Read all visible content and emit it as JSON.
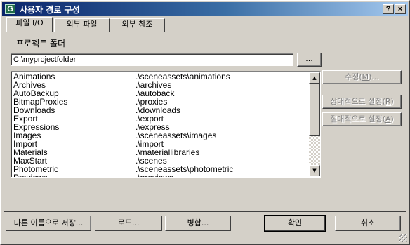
{
  "window": {
    "title": "사용자 경로 구성",
    "icon_letter": "G",
    "help_label": "?",
    "close_label": "×"
  },
  "tabs": [
    {
      "label": "파일 I/O",
      "active": true
    },
    {
      "label": "외부 파일",
      "active": false
    },
    {
      "label": "외부 참조",
      "active": false
    }
  ],
  "section": {
    "label": "프로젝트 폴더"
  },
  "project_folder": {
    "value": "C:\\myprojectfolder",
    "browse_label": "..."
  },
  "paths": [
    {
      "name": "Animations",
      "path": ".\\sceneassets\\animations"
    },
    {
      "name": "Archives",
      "path": ".\\archives"
    },
    {
      "name": "AutoBackup",
      "path": ".\\autoback"
    },
    {
      "name": "BitmapProxies",
      "path": ".\\proxies"
    },
    {
      "name": "Downloads",
      "path": ".\\downloads"
    },
    {
      "name": "Export",
      "path": ".\\export"
    },
    {
      "name": "Expressions",
      "path": ".\\express"
    },
    {
      "name": "Images",
      "path": ".\\sceneassets\\images"
    },
    {
      "name": "Import",
      "path": ".\\import"
    },
    {
      "name": "Materials",
      "path": ".\\materiallibraries"
    },
    {
      "name": "MaxStart",
      "path": ".\\scenes"
    },
    {
      "name": "Photometric",
      "path": ".\\sceneassets\\photometric"
    },
    {
      "name": "Previews",
      "path": ".\\previews"
    }
  ],
  "side_buttons": {
    "modify": {
      "text": "수정(",
      "key": "M",
      "suffix": ")..."
    },
    "relative": {
      "text": "상대적으로 설정(",
      "key": "R",
      "suffix": ")"
    },
    "absolute": {
      "text": "절대적으로 설정(",
      "key": "A",
      "suffix": ")"
    }
  },
  "bottom_buttons": {
    "save_as": "다른 이름으로 저장...",
    "load": "로드...",
    "merge": "병합...",
    "ok": "확인",
    "cancel": "취소"
  },
  "colors": {
    "titlebar_start": "#0a246a",
    "titlebar_end": "#a6caf0",
    "face": "#d4d0c8"
  }
}
